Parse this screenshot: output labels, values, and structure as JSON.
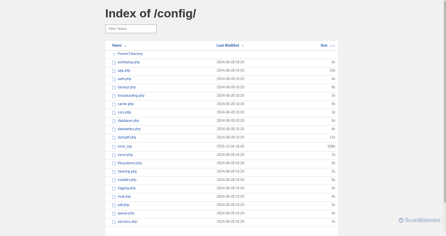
{
  "page": {
    "title": "Index of /config/",
    "filter_placeholder": "Filter Name"
  },
  "columns": {
    "name": "Name",
    "name_sort_icon": "▲",
    "modified": "Last Modified",
    "modified_sort_icon": "▼",
    "size": "Size",
    "size_sort_icon": "▲▼"
  },
  "parent": {
    "label": "Parent Directory",
    "icon": "up-arrow-icon"
  },
  "files": [
    {
      "name": "activitylog.php",
      "modified": "2024-08-28 03:29",
      "size": "2k"
    },
    {
      "name": "app.php",
      "modified": "2024-08-28 03:29",
      "size": "10k"
    },
    {
      "name": "auth.php",
      "modified": "2024-08-28 03:29",
      "size": "5k"
    },
    {
      "name": "backup.php",
      "modified": "2024-08-28 03:29",
      "size": "8k"
    },
    {
      "name": "broadcasting.php",
      "modified": "2024-08-28 03:29",
      "size": "2k"
    },
    {
      "name": "cache.php",
      "modified": "2024-08-28 03:29",
      "size": "4k"
    },
    {
      "name": "cors.php",
      "modified": "2024-08-28 03:29",
      "size": "1k"
    },
    {
      "name": "database.php",
      "modified": "2024-08-28 03:29",
      "size": "6k"
    },
    {
      "name": "datatables.php",
      "modified": "2024-08-28 03:29",
      "size": "4k"
    },
    {
      "name": "dompdf.php",
      "modified": "2024-08-28 03:29",
      "size": "11k"
    },
    {
      "name": "error_log",
      "modified": "2025-12-04 16:46",
      "size": "998k"
    },
    {
      "name": "excel.php",
      "modified": "2024-08-28 03:29",
      "size": "7k"
    },
    {
      "name": "filesystems.php",
      "modified": "2024-08-28 03:29",
      "size": "3k"
    },
    {
      "name": "hashing.php",
      "modified": "2024-08-28 03:29",
      "size": "2k"
    },
    {
      "name": "installer.php",
      "modified": "2024-08-28 03:29",
      "size": "6k"
    },
    {
      "name": "logging.php",
      "modified": "2024-08-28 03:29",
      "size": "3k"
    },
    {
      "name": "mail.php",
      "modified": "2024-08-28 03:29",
      "size": "4k"
    },
    {
      "name": "pdf.php",
      "modified": "2024-08-28 03:29",
      "size": "3k"
    },
    {
      "name": "queue.php",
      "modified": "2024-08-28 03:29",
      "size": "3k"
    },
    {
      "name": "services.php",
      "modified": "2024-08-28 03:29",
      "size": "1k"
    }
  ],
  "watermark": {
    "text": "ScanMalware",
    "icon": "scanmalware-logo-icon"
  },
  "colors": {
    "link": "#2f5db2",
    "muted": "#777777",
    "background": "#f1f1f1"
  }
}
